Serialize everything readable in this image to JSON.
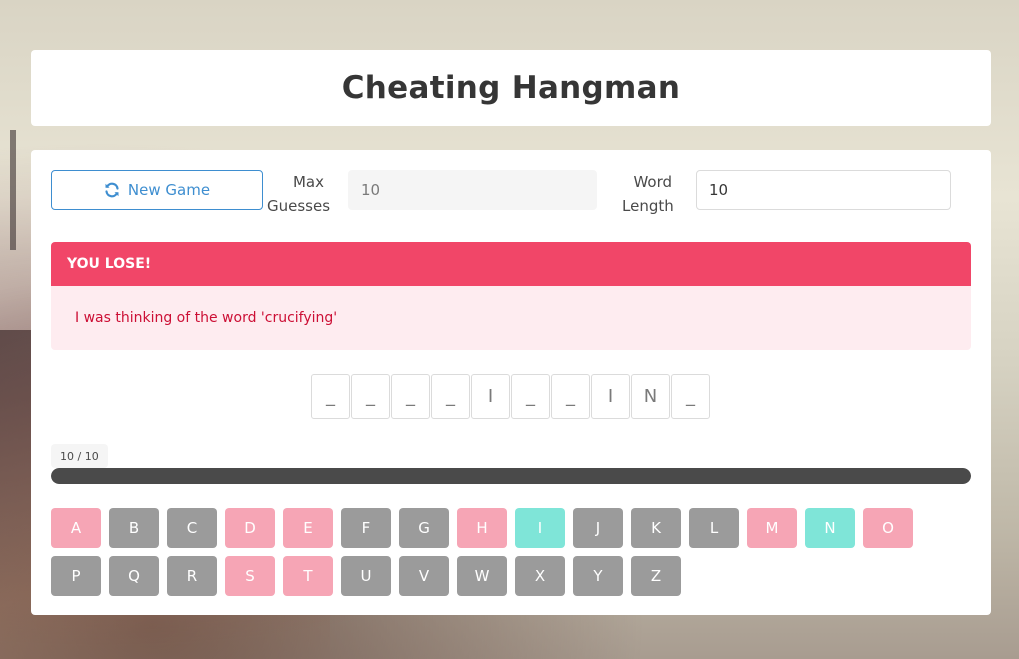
{
  "title": "Cheating Hangman",
  "controls": {
    "new_game_label": "New Game",
    "new_game_icon": "refresh-icon",
    "max_guesses_label_1": "Max",
    "max_guesses_label_2": "Guesses",
    "max_guesses_value": "10",
    "word_length_label_1": "Word",
    "word_length_label_2": "Length",
    "word_length_value": "10"
  },
  "message": {
    "header": "YOU LOSE!",
    "body": "I was thinking of the word 'crucifying'"
  },
  "word_slots": [
    "_",
    "_",
    "_",
    "_",
    "I",
    "_",
    "_",
    "I",
    "N",
    "_"
  ],
  "progress": {
    "label": "10 / 10",
    "used": 10,
    "max": 10
  },
  "colors": {
    "wrong": "#f6a5b5",
    "correct": "#7fe5d8",
    "unused": "#9b9b9b",
    "danger": "#f14668",
    "link": "#3e8ed0"
  },
  "keyboard": [
    {
      "letter": "A",
      "state": "wrong"
    },
    {
      "letter": "B",
      "state": "unused"
    },
    {
      "letter": "C",
      "state": "unused"
    },
    {
      "letter": "D",
      "state": "wrong"
    },
    {
      "letter": "E",
      "state": "wrong"
    },
    {
      "letter": "F",
      "state": "unused"
    },
    {
      "letter": "G",
      "state": "unused"
    },
    {
      "letter": "H",
      "state": "wrong"
    },
    {
      "letter": "I",
      "state": "correct"
    },
    {
      "letter": "J",
      "state": "unused"
    },
    {
      "letter": "K",
      "state": "unused"
    },
    {
      "letter": "L",
      "state": "unused"
    },
    {
      "letter": "M",
      "state": "wrong"
    },
    {
      "letter": "N",
      "state": "correct"
    },
    {
      "letter": "O",
      "state": "wrong"
    },
    {
      "letter": "P",
      "state": "unused"
    },
    {
      "letter": "Q",
      "state": "unused"
    },
    {
      "letter": "R",
      "state": "unused"
    },
    {
      "letter": "S",
      "state": "wrong"
    },
    {
      "letter": "T",
      "state": "wrong"
    },
    {
      "letter": "U",
      "state": "unused"
    },
    {
      "letter": "V",
      "state": "unused"
    },
    {
      "letter": "W",
      "state": "unused"
    },
    {
      "letter": "X",
      "state": "unused"
    },
    {
      "letter": "Y",
      "state": "unused"
    },
    {
      "letter": "Z",
      "state": "unused"
    }
  ]
}
